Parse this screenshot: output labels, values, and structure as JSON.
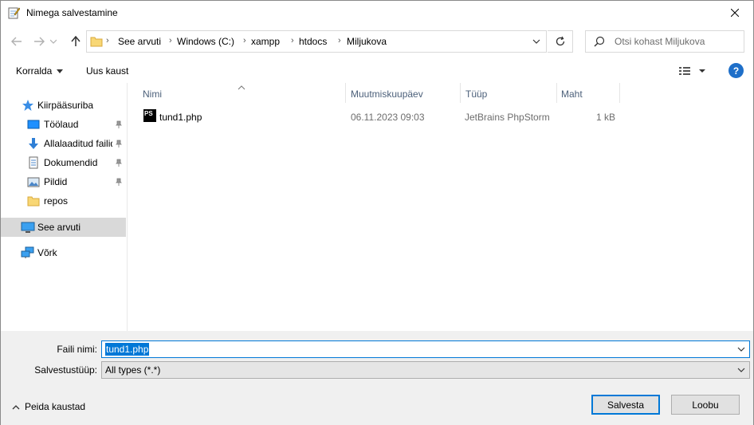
{
  "window": {
    "title": "Nimega salvestamine",
    "close_icon": "close-icon",
    "accent": "#0078d7"
  },
  "address": {
    "crumbs": [
      "See arvuti",
      "Windows (C:)",
      "xampp",
      "htdocs",
      "Miljukova"
    ],
    "search_placeholder": "Otsi kohast Miljukova"
  },
  "toolbar": {
    "organize_label": "Korralda",
    "new_folder_label": "Uus kaust",
    "help_label": "?"
  },
  "nav": {
    "items": [
      {
        "label": "Kiirpääsuriba",
        "icon": "star-icon"
      },
      {
        "label": "Töölaud",
        "icon": "desktop-icon",
        "pinned": true
      },
      {
        "label": "Allalaaditud failid",
        "icon": "download-icon",
        "pinned": true
      },
      {
        "label": "Dokumendid",
        "icon": "document-icon",
        "pinned": true
      },
      {
        "label": "Pildid",
        "icon": "pictures-icon",
        "pinned": true
      },
      {
        "label": "repos",
        "icon": "folder-icon"
      },
      {
        "label": "See arvuti",
        "icon": "computer-icon",
        "selected": true
      },
      {
        "label": "Võrk",
        "icon": "network-icon"
      }
    ]
  },
  "columns": [
    "Nimi",
    "Muutmiskuupäev",
    "Tüüp",
    "Maht"
  ],
  "files": [
    {
      "name": "tund1.php",
      "modified": "06.11.2023 09:03",
      "type": "JetBrains PhpStorm",
      "size": "1 kB",
      "icon": "phpstorm-file-icon",
      "icon_text": "PS"
    }
  ],
  "save": {
    "filename_label": "Faili nimi:",
    "filename_value": "tund1.php",
    "filetype_label": "Salvestustüüp:",
    "filetype_value": "All types (*.*)",
    "hide_folders_label": "Peida kaustad",
    "save_button": "Salvesta",
    "cancel_button": "Loobu"
  }
}
